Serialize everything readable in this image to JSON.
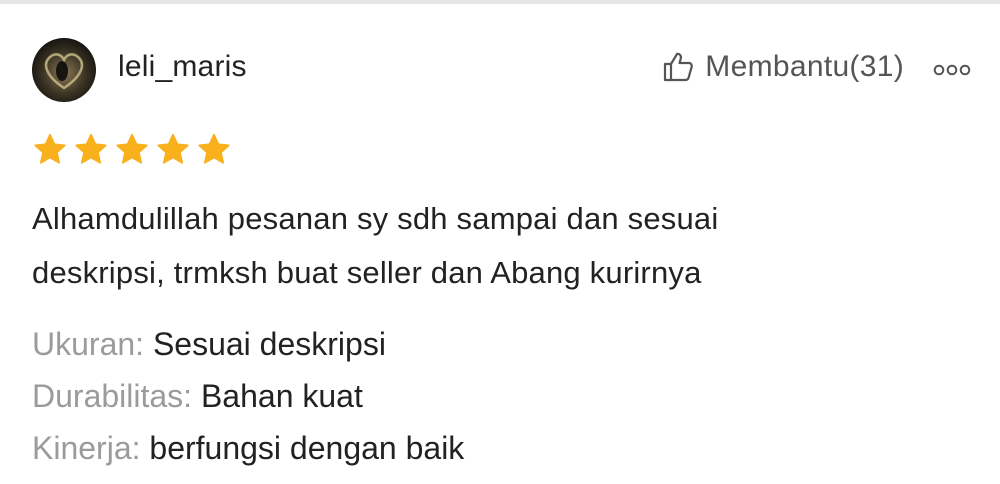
{
  "review": {
    "username": "leli_maris",
    "helpful_label": "Membantu(31)",
    "rating": 5,
    "star_color": "#F8B01C",
    "comment_lines": [
      "Alhamdulillah pesanan sy sdh sampai dan sesuai",
      "deskripsi, trmksh buat seller dan Abang kurirnya"
    ],
    "attributes": [
      {
        "key": "Ukuran:",
        "value": "Sesuai deskripsi"
      },
      {
        "key": "Durabilitas:",
        "value": "Bahan kuat"
      },
      {
        "key": "Kinerja:",
        "value": "berfungsi dengan baik"
      }
    ],
    "icons": {
      "helpful": "thumbs-up-outline-icon",
      "more": "more-options-icon",
      "star": "star-icon"
    }
  }
}
